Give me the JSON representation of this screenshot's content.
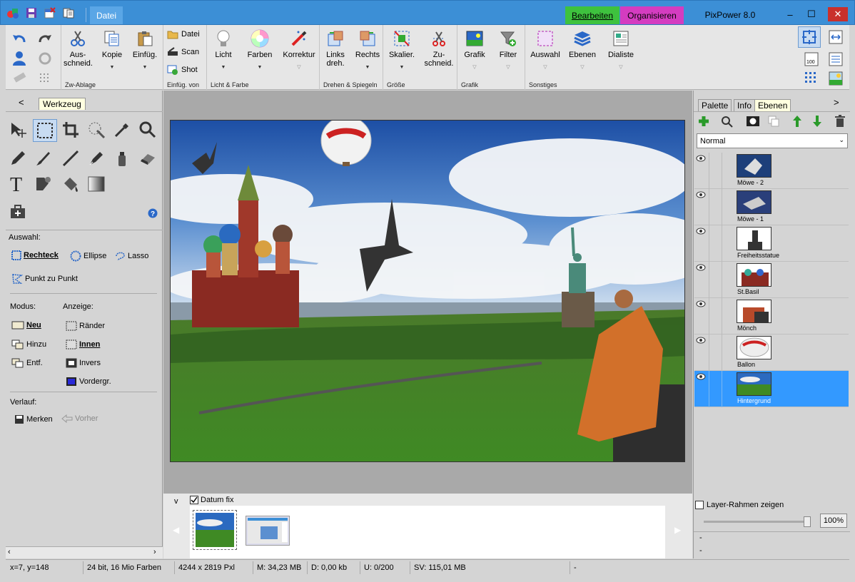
{
  "window": {
    "title": "PixPower 8.0",
    "menu_file": "Datei",
    "tab_edit": "Bearbeiten",
    "tab_organize": "Organisieren",
    "controls": [
      "–",
      "☐",
      "✕"
    ]
  },
  "ribbon": {
    "groups": [
      {
        "label": "Zw-Ablage",
        "buttons": [
          "Aus-\nschneid.",
          "Kopie",
          "Einfüg."
        ]
      },
      {
        "label": "Einfüg. von",
        "items": [
          "Datei",
          "Scan",
          "Shot"
        ]
      },
      {
        "label": "Licht & Farbe",
        "buttons": [
          "Licht",
          "Farben",
          "Korrektur"
        ]
      },
      {
        "label": "Drehen & Spiegeln",
        "buttons": [
          "Links\ndreh.",
          "Rechts"
        ]
      },
      {
        "label": "Größe",
        "buttons": [
          "Skalier.",
          "Zu-\nschneid."
        ]
      },
      {
        "label": "Grafik",
        "buttons": [
          "Grafik",
          "Filter"
        ]
      },
      {
        "label": "Sonstiges",
        "buttons": [
          "Auswahl",
          "Ebenen",
          "Dialiste"
        ]
      }
    ]
  },
  "left_panel": {
    "back": "<",
    "tab": "Werkzeug",
    "auswahl_label": "Auswahl:",
    "selection_types": [
      "Rechteck",
      "Ellipse",
      "Lasso",
      "Punkt zu Punkt"
    ],
    "modus_label": "Modus:",
    "modus": [
      "Neu",
      "Hinzu",
      "Entf."
    ],
    "anzeige_label": "Anzeige:",
    "anzeige": [
      "Ränder",
      "Innen",
      "Invers",
      "Vordergr."
    ],
    "verlauf_label": "Verlauf:",
    "merken": "Merken",
    "vorher": "Vorher"
  },
  "filmstrip": {
    "toggle": "v",
    "date_fix": "Datum fix",
    "date_fix_checked": true
  },
  "right_panel": {
    "tabs": [
      "Palette",
      "Info",
      "Ebenen"
    ],
    "more": ">",
    "blend_mode": "Normal",
    "layers": [
      "Möwe - 2",
      "Möwe - 1",
      "Freiheitsstatue",
      "St.Basil",
      "Mönch",
      "Ballon",
      "Hintergrund"
    ],
    "selected_layer": "Hintergrund",
    "show_frames": "Layer-Rahmen zeigen",
    "opacity": "100%",
    "opacity_level": 1.0,
    "footer": [
      "-",
      "-"
    ]
  },
  "status": {
    "coords": "x=7, y=148",
    "color_depth": "24 bit, 16 Mio Farben",
    "size": "4244 x 2819 Pxl",
    "memory": "M:  34,23 MB",
    "disk": "D:  0,00 kb",
    "undo": "U:  0/200",
    "sv": "SV:  115,01 MB",
    "extra": "-"
  },
  "colors": {
    "titlebar": "#3c8fd6",
    "edit_tab": "#3ec23e",
    "organize_tab": "#d43cc0",
    "selection": "#3399ff"
  }
}
